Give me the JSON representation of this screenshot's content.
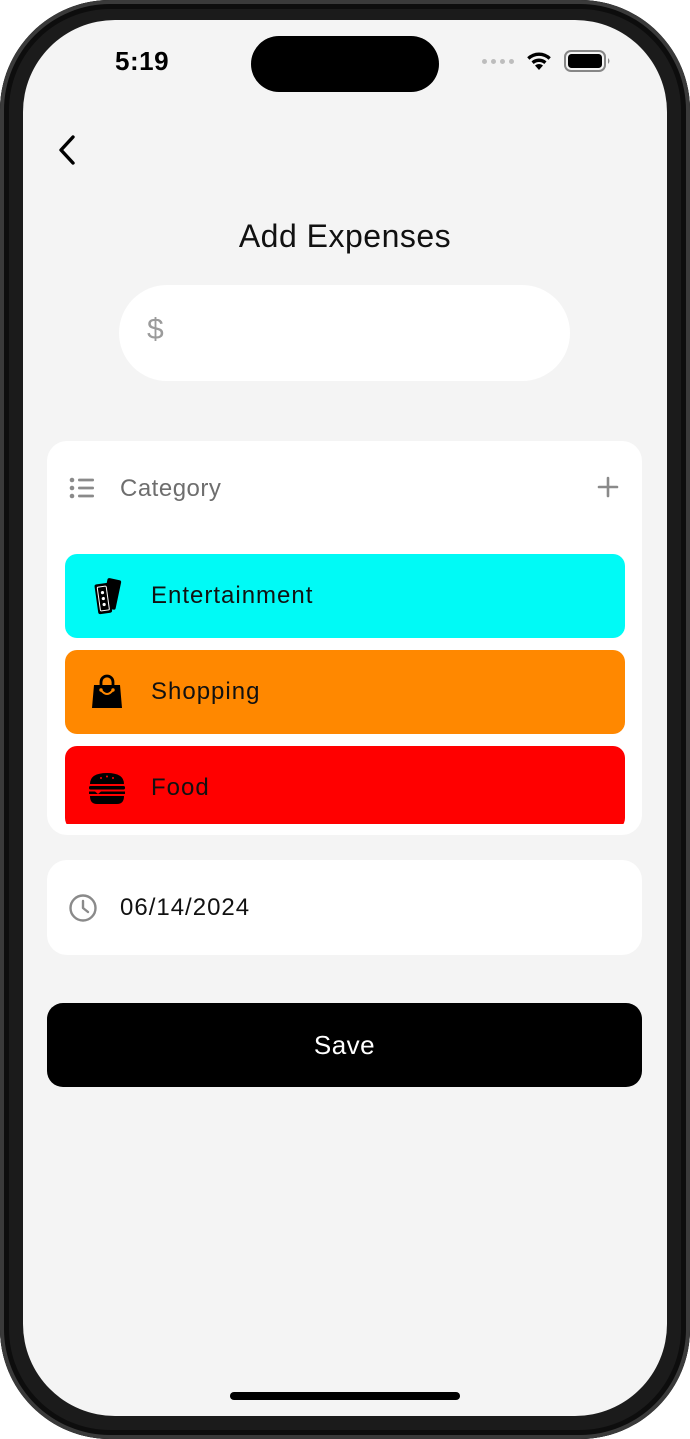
{
  "status_bar": {
    "time": "5:19"
  },
  "header": {
    "title": "Add Expenses"
  },
  "amount": {
    "currency_symbol": "$",
    "value": ""
  },
  "category": {
    "label": "Category",
    "items": [
      {
        "label": "Entertainment",
        "icon": "ticket-icon",
        "color": "#00FAF6"
      },
      {
        "label": "Shopping",
        "icon": "shopping-bag-icon",
        "color": "#FF8800"
      },
      {
        "label": "Food",
        "icon": "burger-icon",
        "color": "#FF0000"
      }
    ]
  },
  "date": {
    "value": "06/14/2024"
  },
  "actions": {
    "save_label": "Save"
  }
}
